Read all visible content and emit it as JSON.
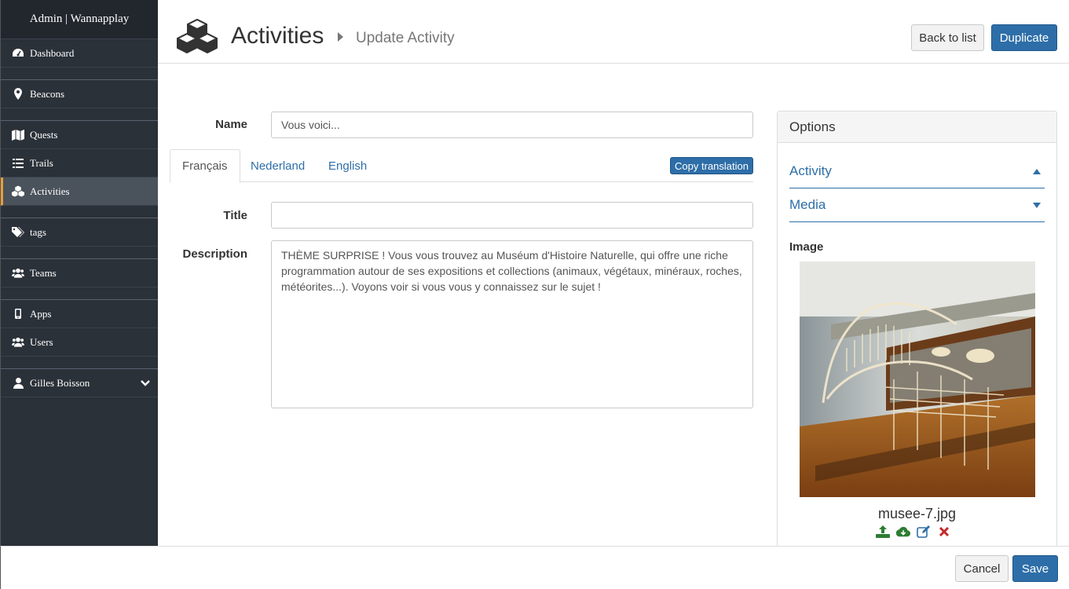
{
  "app": {
    "brand": "Admin | Wannapplay"
  },
  "sidebar": {
    "items": [
      {
        "label": "Dashboard",
        "icon": "dashboard-icon"
      },
      {
        "label": "Beacons",
        "icon": "map-marker-icon"
      },
      {
        "label": "Quests",
        "icon": "map-icon"
      },
      {
        "label": "Trails",
        "icon": "list-icon"
      },
      {
        "label": "Activities",
        "icon": "cubes-icon",
        "active": true
      },
      {
        "label": "tags",
        "icon": "tags-icon"
      },
      {
        "label": "Teams",
        "icon": "users-icon"
      },
      {
        "label": "Apps",
        "icon": "mobile-icon"
      },
      {
        "label": "Users",
        "icon": "users-icon"
      }
    ],
    "user": {
      "label": "Gilles Boisson",
      "icon": "user-icon"
    }
  },
  "header": {
    "title": "Activities",
    "subtitle": "Update Activity",
    "back_label": "Back to list",
    "duplicate_label": "Duplicate"
  },
  "form": {
    "name_label": "Name",
    "name_value": "Vous voici...",
    "tabs": [
      "Français",
      "Nederland",
      "English"
    ],
    "active_tab": "Français",
    "copy_translation_label": "Copy translation",
    "title_label": "Title",
    "title_value": "",
    "description_label": "Description",
    "description_value": "THÈME SURPRISE ! Vous vous trouvez au Muséum d'Histoire Naturelle, qui offre une riche programmation autour de ses expositions et collections (animaux, végétaux, minéraux, roches, météorites...). Voyons voir si vous vous y connaissez sur le sujet !"
  },
  "options": {
    "title": "Options",
    "sections": [
      {
        "label": "Activity",
        "state": "expanded"
      },
      {
        "label": "Media",
        "state": "collapsed"
      }
    ],
    "image_label": "Image",
    "image_filename": "musee-7.jpg",
    "image_actions": [
      "upload-icon",
      "cloud-download-icon",
      "edit-icon",
      "delete-icon"
    ]
  },
  "footer": {
    "cancel_label": "Cancel",
    "save_label": "Save"
  },
  "colors": {
    "sidebar_bg": "#2b3139",
    "primary": "#2e6ea8",
    "active_accent": "#e6a03c",
    "success": "#2e7d32",
    "danger": "#c62828"
  }
}
